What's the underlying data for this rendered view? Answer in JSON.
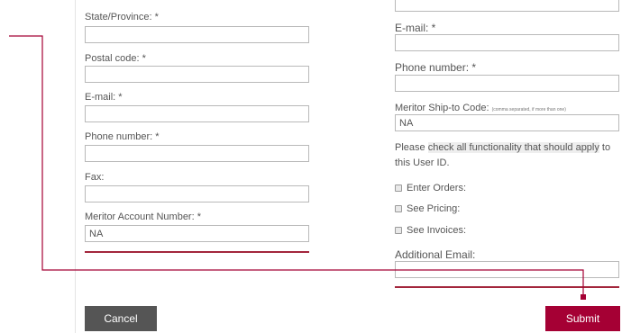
{
  "left_form": {
    "state_label": "State/Province: *",
    "state_value": "",
    "postal_label": "Postal code: *",
    "postal_value": "",
    "email_label": "E-mail: *",
    "email_value": "",
    "phone_label": "Phone number: *",
    "phone_value": "",
    "fax_label": "Fax:",
    "fax_value": "",
    "account_label": "Meritor Account Number: *",
    "account_value": "NA"
  },
  "right_form": {
    "email_label": "E-mail: *",
    "email_value": "",
    "phone_label": "Phone number: *",
    "phone_value": "",
    "shipto_label": "Meritor Ship-to Code:",
    "shipto_hint": "(comma separated, if more than one)",
    "shipto_value": "NA",
    "instructions_pre": "Please ",
    "instructions_highlight": "check all functionality that should apply",
    "instructions_post": " to this User ID.",
    "checkboxes": [
      "Enter Orders:",
      "See Pricing:",
      "See Invoices:"
    ],
    "additional_email_label": "Additional Email:",
    "additional_email_value": ""
  },
  "actions": {
    "cancel_label": "Cancel",
    "submit_label": "Submit"
  },
  "colors": {
    "accent": "#a50034",
    "divider": "#a3263c",
    "cancel_bg": "#555555",
    "connector": "#a50034"
  }
}
